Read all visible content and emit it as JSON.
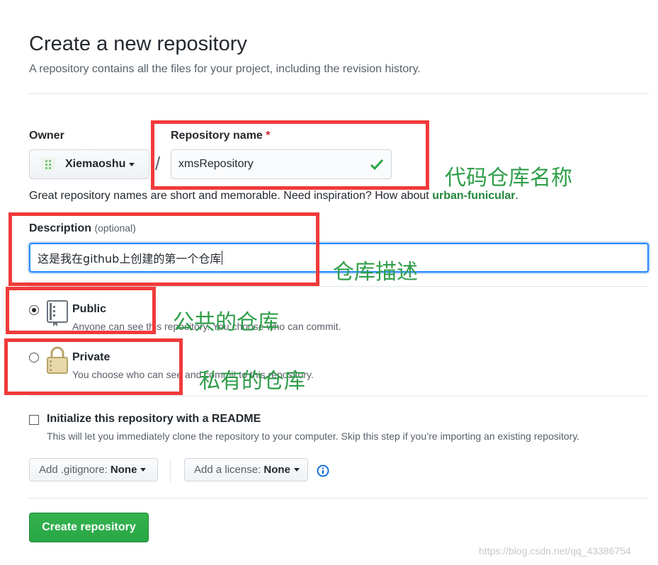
{
  "header": {
    "title": "Create a new repository",
    "subtitle": "A repository contains all the files for your project, including the revision history."
  },
  "owner": {
    "label": "Owner",
    "value": "Xiemaoshu",
    "separator": "/"
  },
  "repo_name": {
    "label": "Repository name",
    "required_mark": "*",
    "value": "xmsRepository"
  },
  "name_hint": {
    "text": "Great repository names are short and memorable. Need inspiration? How about ",
    "suggestion": "urban-funicular",
    "end": "."
  },
  "description": {
    "label": "Description",
    "optional": "(optional)",
    "value": "这是我在github上创建的第一个仓库"
  },
  "visibility": {
    "public": {
      "title": "Public",
      "desc": "Anyone can see this repository. You choose who can commit.",
      "selected": true
    },
    "private": {
      "title": "Private",
      "desc": "You choose who can see and commit to this repository.",
      "selected": false
    }
  },
  "readme": {
    "title": "Initialize this repository with a README",
    "desc": "This will let you immediately clone the repository to your computer. Skip this step if you’re importing an existing repository.",
    "checked": false
  },
  "gitignore": {
    "label": "Add .gitignore:",
    "value": "None"
  },
  "license": {
    "label": "Add a license:",
    "value": "None"
  },
  "create_button": "Create repository",
  "annotations": {
    "repo_name": "代码仓库名称",
    "description": "仓库描述",
    "public": "公共的仓库",
    "private": "私有的仓库"
  },
  "watermark": "https://blog.csdn.net/qq_43386754",
  "colors": {
    "annotation_box": "#f03a3a",
    "annotation_text": "#2f9e4a",
    "create_button": "#28a745",
    "focus_border": "#2188ff",
    "suggestion": "#22863a"
  },
  "icons": {
    "owner_avatar": "identicon",
    "name_valid": "check-icon",
    "public": "repo-book-icon",
    "private": "lock-icon",
    "info": "info-icon"
  }
}
